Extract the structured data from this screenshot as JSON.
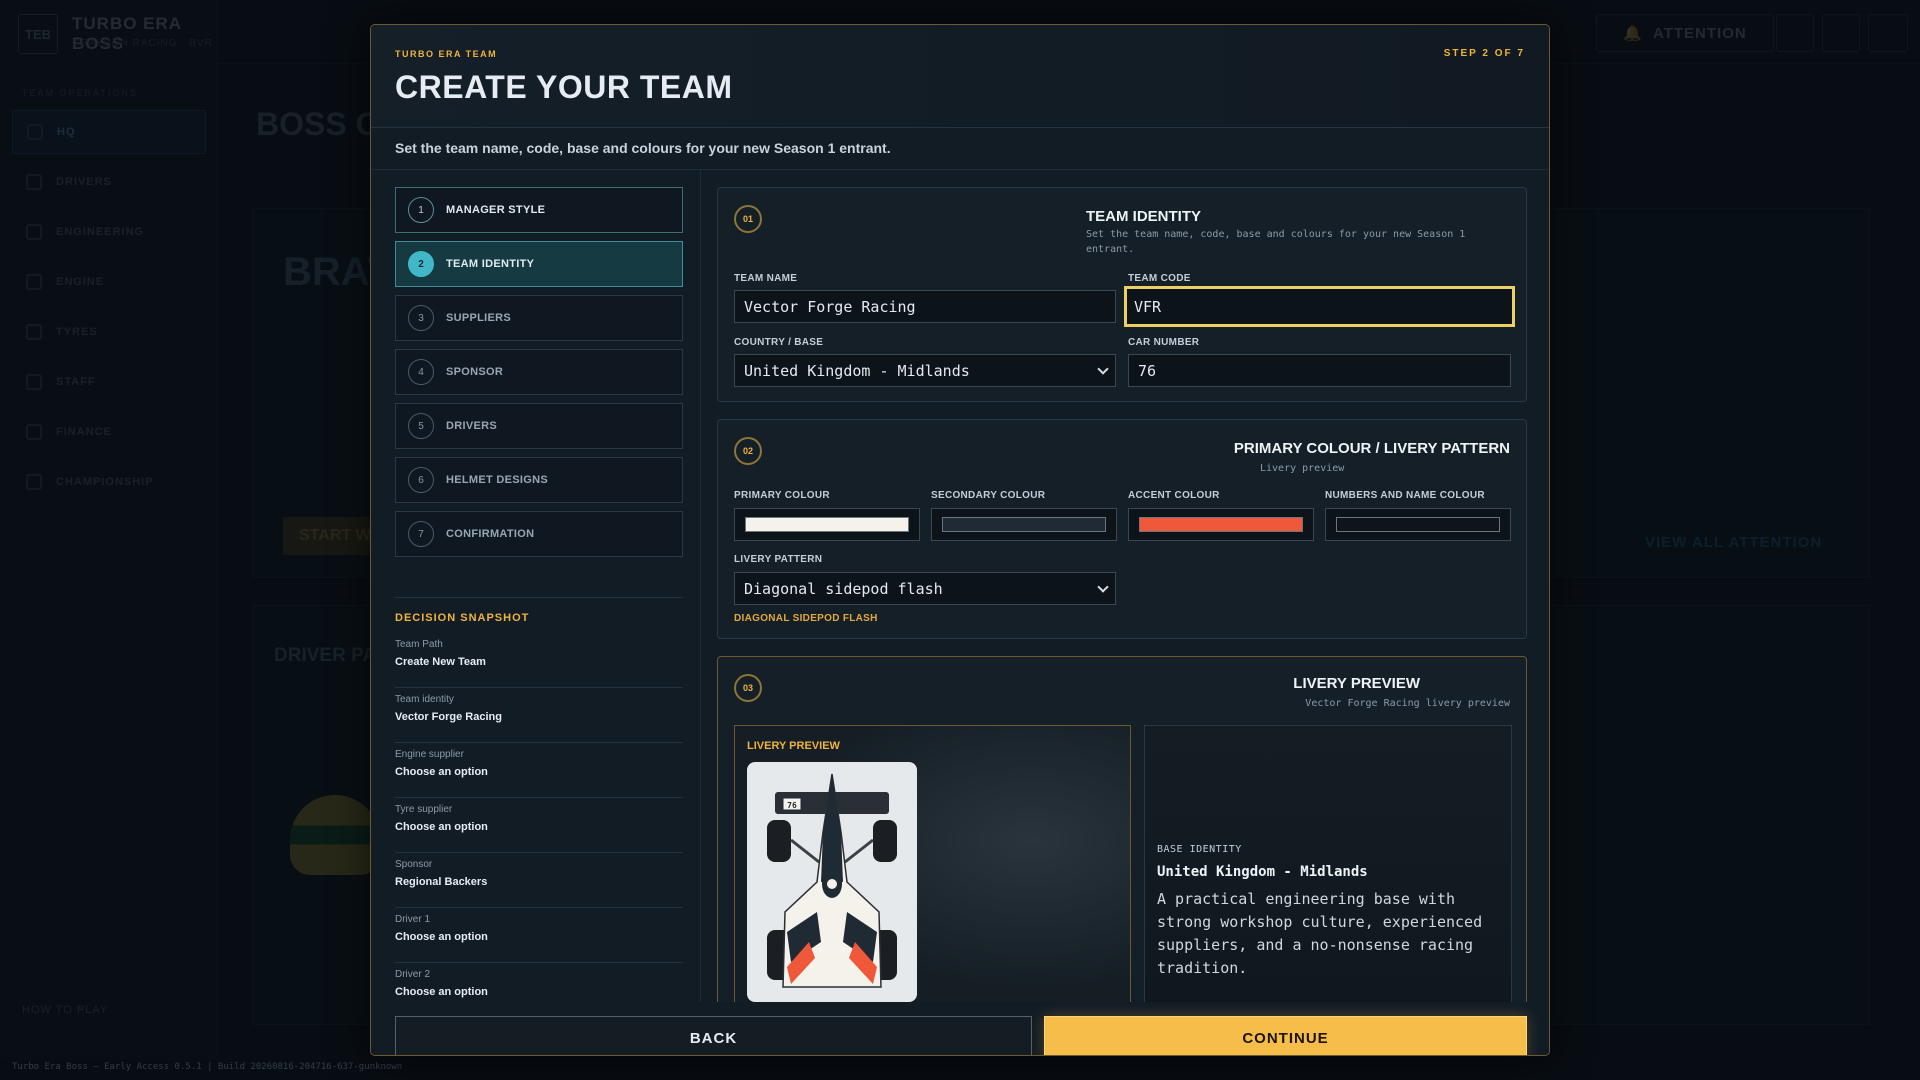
{
  "background": {
    "app_logo": "TEB",
    "app_title": "TURBO ERA BOSS",
    "app_subtitle": "GRAYDON RACING · BVR",
    "section_label": "TEAM OPERATIONS",
    "nav": [
      {
        "label": "HQ",
        "icon": "home-icon"
      },
      {
        "label": "DRIVERS",
        "icon": "helmet-icon"
      },
      {
        "label": "ENGINEERING",
        "icon": "wrench-icon"
      },
      {
        "label": "ENGINE",
        "icon": "engine-icon"
      },
      {
        "label": "TYRES",
        "icon": "tyre-icon"
      },
      {
        "label": "STAFF",
        "icon": "people-icon"
      },
      {
        "label": "FINANCE",
        "icon": "wallet-icon"
      },
      {
        "label": "CHAMPIONSHIP",
        "icon": "trophy-icon"
      }
    ],
    "how_to_play": "HOW TO PLAY",
    "attention_label": "ATTENTION",
    "page_title": "BOSS O",
    "brav": "BRAV",
    "start": "START W",
    "view_all": "VIEW ALL ATTENTION",
    "driver_heading": "DRIVER PA",
    "build_info": "Turbo Era Boss — Early Access 0.5.1 | Build 20260816-204716-637-gunknown"
  },
  "modal": {
    "eyebrow": "TURBO ERA TEAM",
    "step_indicator": "STEP 2 OF 7",
    "title": "CREATE YOUR TEAM",
    "description": "Set the team name, code, base and colours for your new Season 1 entrant.",
    "steps": [
      {
        "num": "1",
        "label": "MANAGER STYLE",
        "state": "done"
      },
      {
        "num": "2",
        "label": "TEAM IDENTITY",
        "state": "active"
      },
      {
        "num": "3",
        "label": "SUPPLIERS",
        "state": "pending"
      },
      {
        "num": "4",
        "label": "SPONSOR",
        "state": "pending"
      },
      {
        "num": "5",
        "label": "DRIVERS",
        "state": "pending"
      },
      {
        "num": "6",
        "label": "HELMET DESIGNS",
        "state": "pending"
      },
      {
        "num": "7",
        "label": "CONFIRMATION",
        "state": "pending"
      }
    ],
    "snapshot": {
      "title": "DECISION SNAPSHOT",
      "rows": [
        {
          "label": "Team Path",
          "value": "Create New Team"
        },
        {
          "label": "Team identity",
          "value": "Vector Forge Racing"
        },
        {
          "label": "Engine supplier",
          "value": "Choose an option"
        },
        {
          "label": "Tyre supplier",
          "value": "Choose an option"
        },
        {
          "label": "Sponsor",
          "value": "Regional Backers"
        },
        {
          "label": "Driver 1",
          "value": "Choose an option"
        },
        {
          "label": "Driver 2",
          "value": "Choose an option"
        }
      ]
    },
    "identity": {
      "badge": "01",
      "title": "TEAM IDENTITY",
      "subtitle": "Set the team name, code, base and colours for your new Season 1 entrant.",
      "team_name_label": "TEAM NAME",
      "team_name_value": "Vector Forge Racing",
      "team_code_label": "TEAM CODE",
      "team_code_value": "VFR",
      "country_label": "COUNTRY / BASE",
      "country_value": "United Kingdom - Midlands",
      "car_number_label": "CAR NUMBER",
      "car_number_value": "76"
    },
    "colours": {
      "badge": "02",
      "title": "PRIMARY COLOUR / LIVERY PATTERN",
      "subtitle": "Livery preview",
      "primary_label": "PRIMARY COLOUR",
      "primary_color": "#f4f2ea",
      "secondary_label": "SECONDARY COLOUR",
      "secondary_color": "#1f2a35",
      "accent_label": "ACCENT COLOUR",
      "accent_color": "#f0583a",
      "numbers_label": "NUMBERS AND NAME COLOUR",
      "numbers_color": "#0f141a",
      "pattern_label": "LIVERY PATTERN",
      "pattern_value": "Diagonal sidepod flash",
      "pattern_note": "DIAGONAL SIDEPOD FLASH"
    },
    "preview": {
      "badge": "03",
      "title": "LIVERY PREVIEW",
      "subtitle": "Vector Forge Racing livery preview",
      "card_label": "LIVERY PREVIEW",
      "car_number": "76",
      "base_identity_label": "BASE IDENTITY",
      "base_identity_title": "United Kingdom - Midlands",
      "base_identity_text": "A practical engineering base with strong workshop culture, experienced suppliers, and a no-nonsense racing tradition."
    },
    "back_label": "BACK",
    "continue_label": "CONTINUE"
  }
}
